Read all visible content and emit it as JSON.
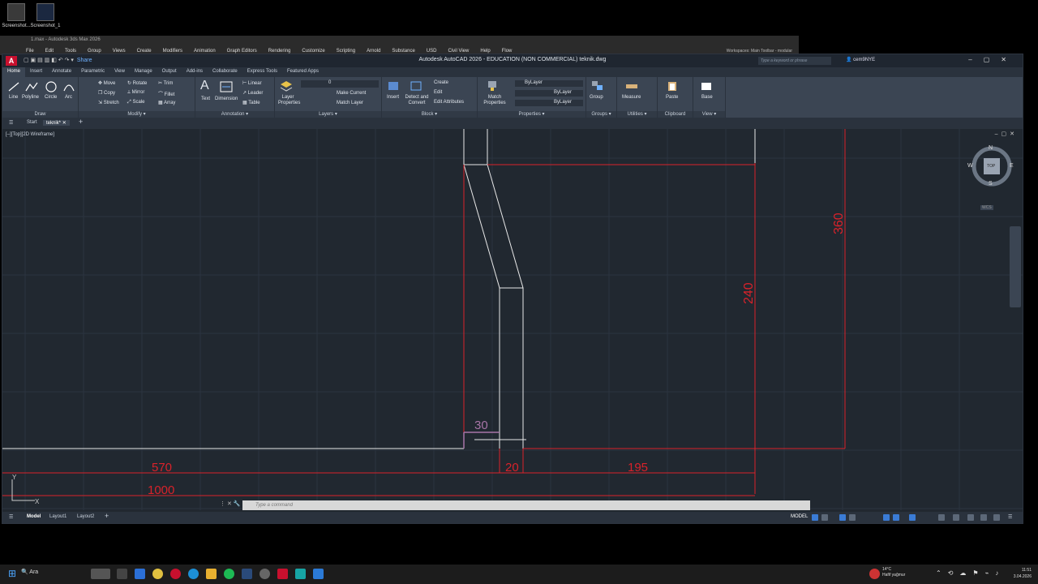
{
  "desktop": {
    "icons": [
      {
        "label": "Screenshot..."
      },
      {
        "label": "Screenshot_1"
      }
    ]
  },
  "max_window": {
    "title": "1.max - Autodesk 3ds Max 2026",
    "menus": [
      "File",
      "Edit",
      "Tools",
      "Group",
      "Views",
      "Create",
      "Modifiers",
      "Animation",
      "Graph Editors",
      "Rendering",
      "Customize",
      "Scripting",
      "Arnold",
      "Substance",
      "USD",
      "Civil View",
      "Help",
      "Flow"
    ],
    "workspace": "Workspaces:  Main Toolbar - modular"
  },
  "acad": {
    "title": "Autodesk AutoCAD 2026 - EDUCATION (NON COMMERCIAL)   teknik.dwg",
    "share": "Share",
    "search_placeholder": "Type a keyword or phrase",
    "user": "cem9NYE",
    "ribbon_tabs": [
      "Home",
      "Insert",
      "Annotate",
      "Parametric",
      "View",
      "Manage",
      "Output",
      "Add-ins",
      "Collaborate",
      "Express Tools",
      "Featured Apps"
    ],
    "panels": {
      "draw": {
        "title": "Draw",
        "line": "Line",
        "polyline": "Polyline",
        "circle": "Circle",
        "arc": "Arc"
      },
      "modify": {
        "title": "Modify",
        "move": "Move",
        "rotate": "Rotate",
        "trim": "Trim",
        "copy": "Copy",
        "mirror": "Mirror",
        "fillet": "Fillet",
        "stretch": "Stretch",
        "scale": "Scale",
        "array": "Array"
      },
      "annotation": {
        "title": "Annotation",
        "text": "Text",
        "dimension": "Dimension",
        "linear": "Linear",
        "leader": "Leader",
        "table": "Table"
      },
      "layers": {
        "title": "Layers",
        "layer_props": "Layer Properties",
        "make_current": "Make Current",
        "match_layer": "Match Layer",
        "layer_value": "0"
      },
      "block": {
        "title": "Block",
        "insert": "Insert",
        "detect": "Detect and Convert",
        "create": "Create",
        "edit": "Edit",
        "edit_attr": "Edit Attributes"
      },
      "properties": {
        "title": "Properties",
        "match": "Match Properties",
        "bylayer1": "ByLayer",
        "bylayer2": "ByLayer",
        "bylayer3": "ByLayer"
      },
      "groups": {
        "title": "Groups",
        "group": "Group"
      },
      "utilities": {
        "title": "Utilities",
        "measure": "Measure"
      },
      "clipboard": {
        "title": "Clipboard",
        "paste": "Paste"
      },
      "view": {
        "title": "View",
        "base": "Base"
      }
    },
    "doc_tabs": {
      "start": "Start",
      "active": "teknik*"
    },
    "viewport_label": "[–][Top][2D Wireframe]",
    "viewcube": {
      "n": "N",
      "s": "S",
      "e": "E",
      "w": "W",
      "top": "TOP",
      "wcs": "WCS"
    },
    "dimensions": {
      "d360": "360",
      "d240": "240",
      "d30": "30",
      "d570": "570",
      "d20": "20",
      "d195": "195",
      "d1000": "1000"
    },
    "ucs": {
      "x": "X",
      "y": "Y"
    },
    "command_placeholder": "Type a command",
    "status_tabs": [
      "Model",
      "Layout1",
      "Layout2"
    ],
    "model_label": "MODEL",
    "colors": {
      "dim": "#d9222a",
      "geom": "#e8e8e8",
      "grid": "#2c3440",
      "dim_purple": "#a774a7"
    }
  },
  "taskbar": {
    "search": "Ara",
    "weather_temp": "14°C",
    "weather_desc": "Hafif yağmur",
    "time": "11:51",
    "date": "3.04.2026"
  }
}
